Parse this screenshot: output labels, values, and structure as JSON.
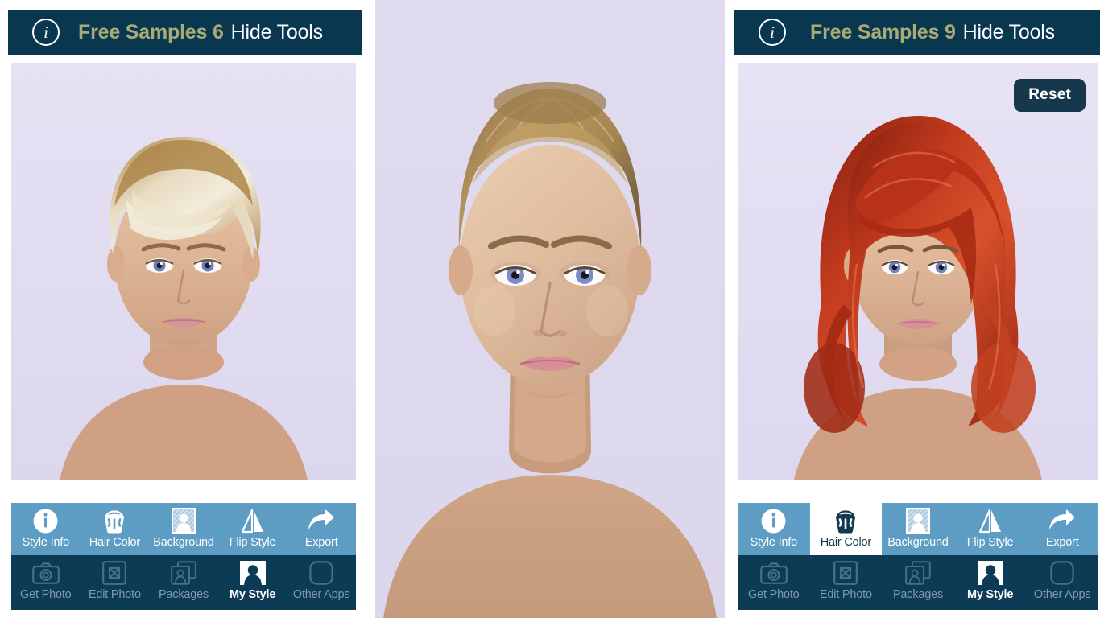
{
  "app": {
    "panel_count": 3,
    "accent_olive": "#a6ab78",
    "header_bg": "#0a3750",
    "toolbar_light_bg": "#5d9cc3",
    "toolbar_dark_bg": "#0d3a54",
    "photo_bg": "#ded9ee"
  },
  "panels": {
    "left": {
      "header": {
        "info_icon": "info-circle-icon",
        "free_samples_label": "Free Samples 6",
        "hide_tools_label": "Hide Tools"
      },
      "photo": {
        "description": "Woman with short blonde pixie hairstyle on lavender background",
        "hair_color": "#c8a46a",
        "hair_highlight": "#efe6d2",
        "background": "#e3def1"
      },
      "reset_button": null,
      "toolbar_top": [
        {
          "label": "Style Info",
          "icon": "info-circle-icon",
          "selected": false
        },
        {
          "label": "Hair Color",
          "icon": "paint-bucket-icon",
          "selected": false
        },
        {
          "label": "Background",
          "icon": "person-square-icon",
          "selected": false
        },
        {
          "label": "Flip Style",
          "icon": "flip-mirror-icon",
          "selected": false
        },
        {
          "label": "Export",
          "icon": "share-arrow-icon",
          "selected": false
        }
      ],
      "toolbar_bottom": [
        {
          "label": "Get Photo",
          "icon": "camera-icon",
          "selected": false
        },
        {
          "label": "Edit Photo",
          "icon": "expand-arrows-icon",
          "selected": false
        },
        {
          "label": "Packages",
          "icon": "stacked-cards-icon",
          "selected": false
        },
        {
          "label": "My Style",
          "icon": "person-filled-icon",
          "selected": true
        },
        {
          "label": "Other Apps",
          "icon": "rounded-square-icon",
          "selected": false
        }
      ]
    },
    "center": {
      "header": null,
      "photo": {
        "description": "Woman with blonde hair pulled back, full face portrait on lavender background",
        "hair_color": "#a2865c",
        "background": "#ded9ee"
      },
      "toolbar_top": null,
      "toolbar_bottom": null
    },
    "right": {
      "header": {
        "info_icon": "info-circle-icon",
        "free_samples_label": "Free Samples 9",
        "hide_tools_label": "Hide Tools"
      },
      "photo": {
        "description": "Woman with medium-length wavy red hairstyle on lavender background",
        "hair_color": "#b2331d",
        "hair_highlight": "#e2684a",
        "background": "#e3def1"
      },
      "reset_button": {
        "label": "Reset",
        "bg": "#16384c",
        "fg": "#ffffff"
      },
      "toolbar_top": [
        {
          "label": "Style Info",
          "icon": "info-circle-icon",
          "selected": false
        },
        {
          "label": "Hair Color",
          "icon": "paint-bucket-icon",
          "selected": true
        },
        {
          "label": "Background",
          "icon": "person-square-icon",
          "selected": false
        },
        {
          "label": "Flip Style",
          "icon": "flip-mirror-icon",
          "selected": false
        },
        {
          "label": "Export",
          "icon": "share-arrow-icon",
          "selected": false
        }
      ],
      "toolbar_bottom": [
        {
          "label": "Get Photo",
          "icon": "camera-icon",
          "selected": false
        },
        {
          "label": "Edit Photo",
          "icon": "expand-arrows-icon",
          "selected": false
        },
        {
          "label": "Packages",
          "icon": "stacked-cards-icon",
          "selected": false
        },
        {
          "label": "My Style",
          "icon": "person-filled-icon",
          "selected": true
        },
        {
          "label": "Other Apps",
          "icon": "rounded-square-icon",
          "selected": false
        }
      ]
    }
  }
}
